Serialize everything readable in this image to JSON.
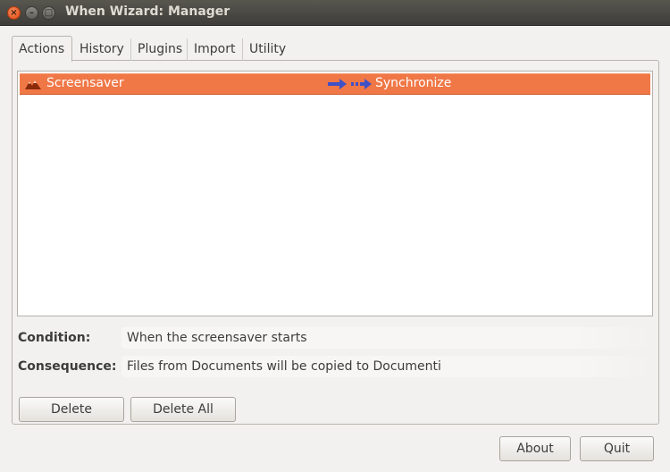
{
  "window": {
    "title": "When Wizard: Manager",
    "controls": {
      "close": "×",
      "minimize": "–",
      "maximize": "□"
    }
  },
  "tabs": [
    {
      "label": "Actions",
      "active": true
    },
    {
      "label": "History"
    },
    {
      "label": "Plugins"
    },
    {
      "label": "Import"
    },
    {
      "label": "Utility"
    }
  ],
  "actions_list": {
    "rows": [
      {
        "condition_icon": "screensaver-icon",
        "condition": "Screensaver",
        "consequence_icon": "arrow-right-icon",
        "consequence": "Synchronize",
        "selected": true
      }
    ]
  },
  "details": {
    "condition_label": "Condition:",
    "condition_value": "When the screensaver starts",
    "consequence_label": "Consequence:",
    "consequence_value": "Files from Documents will be copied to Documenti"
  },
  "buttons": {
    "delete": "Delete",
    "delete_all": "Delete All",
    "about": "About",
    "quit": "Quit"
  },
  "colors": {
    "selection": "#f07746",
    "arrow": "#3f51c7",
    "close_button": "#e8561c"
  }
}
